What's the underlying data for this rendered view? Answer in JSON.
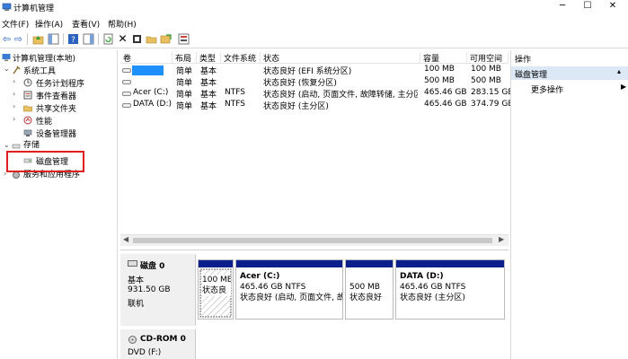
{
  "window": {
    "title": "计算机管理"
  },
  "menu": [
    "文件(F)",
    "操作(A)",
    "查看(V)",
    "帮助(H)"
  ],
  "toolbar": {
    "icons": [
      "back-icon",
      "forward-icon",
      "up-folder-icon",
      "show-hide-tree-icon",
      "help-icon",
      "show-panel-icon",
      "refresh-icon",
      "delete-icon",
      "properties-icon",
      "open-icon",
      "export-icon",
      "settings-icon"
    ]
  },
  "tree": {
    "root": "计算机管理(本地)",
    "system_tools": "系统工具",
    "task_scheduler": "任务计划程序",
    "event_viewer": "事件查看器",
    "shared_folders": "共享文件夹",
    "performance": "性能",
    "device_manager": "设备管理器",
    "storage": "存储",
    "disk_management": "磁盘管理",
    "services_apps": "服务和应用程序"
  },
  "list": {
    "headers": [
      "卷",
      "布局",
      "类型",
      "文件系统",
      "状态",
      "容量",
      "可用空间"
    ],
    "rows": [
      {
        "volume": "",
        "layout": "简单",
        "type": "基本",
        "fs": "",
        "status": "状态良好 (EFI 系统分区)",
        "capacity": "100 MB",
        "free": "100 MB"
      },
      {
        "volume": "",
        "layout": "简单",
        "type": "基本",
        "fs": "",
        "status": "状态良好 (恢复分区)",
        "capacity": "500 MB",
        "free": "500 MB"
      },
      {
        "volume": "Acer (C:)",
        "layout": "简单",
        "type": "基本",
        "fs": "NTFS",
        "status": "状态良好 (启动, 页面文件, 故障转储, 主分区)",
        "capacity": "465.46 GB",
        "free": "283.15 GB"
      },
      {
        "volume": "DATA (D:)",
        "layout": "简单",
        "type": "基本",
        "fs": "NTFS",
        "status": "状态良好 (主分区)",
        "capacity": "465.46 GB",
        "free": "374.79 GB"
      }
    ]
  },
  "disk0": {
    "name": "磁盘 0",
    "type": "基本",
    "size": "931.50 GB",
    "state": "联机",
    "partitions": [
      {
        "title": "",
        "line1": "100 ME",
        "line2": "状态良"
      },
      {
        "title": "Acer  (C:)",
        "line1": "465.46 GB NTFS",
        "line2": "状态良好 (启动, 页面文件, 故"
      },
      {
        "title": "",
        "line1": "500 MB",
        "line2": "状态良好"
      },
      {
        "title": "DATA  (D:)",
        "line1": "465.46 GB NTFS",
        "line2": "状态良好 (主分区)"
      }
    ]
  },
  "cdrom0": {
    "name": "CD-ROM 0",
    "drive": "DVD (F:)"
  },
  "actions": {
    "title": "操作",
    "section": "磁盘管理",
    "more": "更多操作"
  },
  "colors": {
    "partition_bar": "#0a1e8c",
    "selection_fill": "#1e90ff",
    "highlight_box": "#e02020",
    "section_bg": "#dce8f5"
  }
}
